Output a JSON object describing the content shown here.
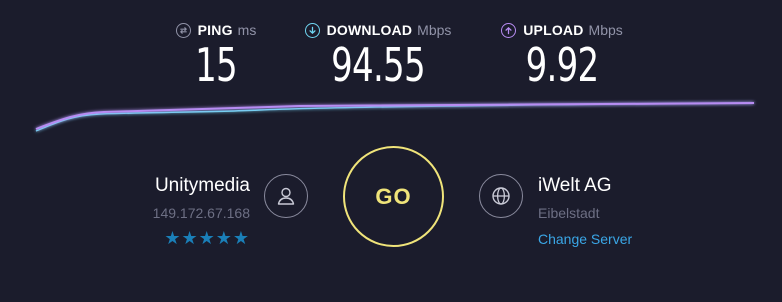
{
  "metrics": {
    "ping": {
      "label": "PING",
      "unit": "ms",
      "value": "15",
      "icon": "ping-arrows-icon",
      "color": "#9193a8"
    },
    "download": {
      "label": "DOWNLOAD",
      "unit": "Mbps",
      "value": "94.55",
      "icon": "download-arrow-icon",
      "color": "#6fd6f2"
    },
    "upload": {
      "label": "UPLOAD",
      "unit": "Mbps",
      "value": "9.92",
      "icon": "upload-arrow-icon",
      "color": "#b78cf2"
    }
  },
  "isp": {
    "name": "Unitymedia",
    "ip": "149.172.67.168",
    "rating": 5,
    "stars": "★★★★★",
    "icon": "user-icon"
  },
  "go_button": {
    "label": "GO",
    "color": "#f0e47a"
  },
  "server": {
    "name": "iWelt AG",
    "location": "Eibelstadt",
    "change_label": "Change Server",
    "icon": "globe-icon"
  }
}
